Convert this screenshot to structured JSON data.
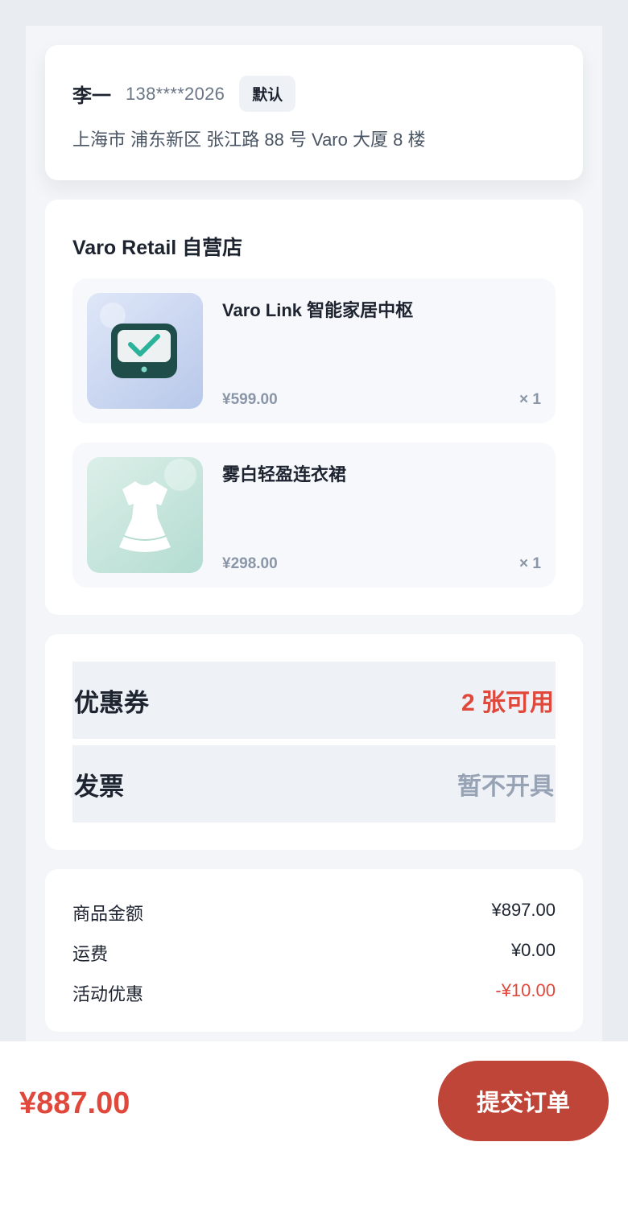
{
  "address": {
    "name": "李一",
    "phone": "138****2026",
    "tag": "默认",
    "detail": "上海市 浦东新区 张江路 88 号 Varo 大厦 8 楼"
  },
  "store": {
    "name": "Varo Retail 自营店",
    "items": [
      {
        "title": "Varo Link 智能家居中枢",
        "price": "¥599.00",
        "qty": "× 1",
        "icon": "smart-hub-device-icon"
      },
      {
        "title": "雾白轻盈连衣裙",
        "price": "¥298.00",
        "qty": "× 1",
        "icon": "dress-icon"
      }
    ]
  },
  "options": {
    "coupon": {
      "label": "优惠券",
      "value": "2 张可用"
    },
    "invoice": {
      "label": "发票",
      "value": "暂不开具"
    }
  },
  "summary": {
    "goods": {
      "label": "商品金额",
      "value": "¥897.00"
    },
    "shipping": {
      "label": "运费",
      "value": "¥0.00"
    },
    "discount": {
      "label": "活动优惠",
      "value": "-¥10.00"
    }
  },
  "bottom": {
    "total": "¥887.00",
    "submit_label": "提交订单"
  },
  "colors": {
    "accent_red": "#e0483b",
    "submit_bg": "#bf4538"
  }
}
